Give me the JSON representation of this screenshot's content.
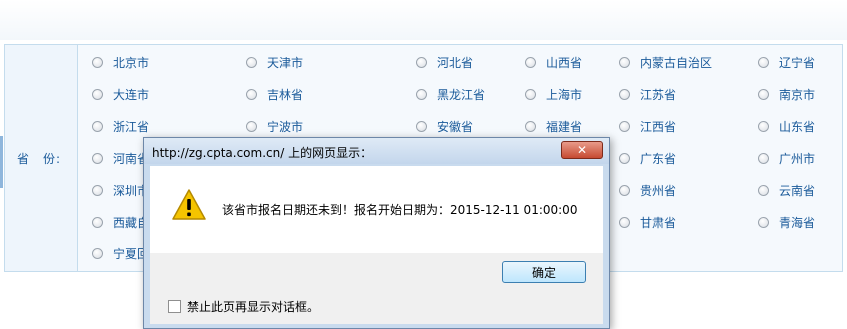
{
  "form": {
    "province_label": "省　份:",
    "provinces": [
      [
        "北京市",
        "天津市",
        "河北省",
        "山西省",
        "内蒙古自治区",
        "辽宁省"
      ],
      [
        "大连市",
        "吉林省",
        "黑龙江省",
        "上海市",
        "江苏省",
        "南京市"
      ],
      [
        "浙江省",
        "宁波市",
        "安徽省",
        "福建省",
        "江西省",
        "山东省"
      ],
      [
        "河南省",
        "",
        "",
        "",
        "广东省",
        "广州市"
      ],
      [
        "深圳市",
        "",
        "",
        "",
        "贵州省",
        "云南省"
      ],
      [
        "西藏自",
        "",
        "",
        "",
        "甘肃省",
        "青海省"
      ],
      [
        "宁夏回",
        "",
        "",
        "",
        "",
        ""
      ]
    ]
  },
  "dialog": {
    "title": "http://zg.cpta.com.cn/ 上的网页显示：",
    "close_label": "✕",
    "icon": "warning-icon",
    "message": "该省市报名日期还未到！报名开始日期为：2015-12-11 01:00:00",
    "ok_label": "确定",
    "suppress_label": "禁止此页再显示对话框。"
  },
  "colors": {
    "link_text": "#1a5a9a",
    "table_border": "#c4dced",
    "table_bg": "#eef5fc",
    "dialog_frame": "#c9dbee",
    "close_button": "#c64a32",
    "warning_fill": "#f5c400"
  }
}
